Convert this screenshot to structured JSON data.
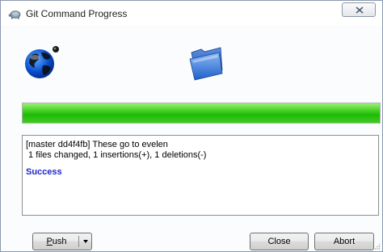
{
  "window": {
    "title": "Git Command Progress",
    "title_icon": "tortoisegit-icon",
    "close_icon": "close-icon"
  },
  "status_icons": {
    "remote": "globe-icon",
    "local": "folder-icon"
  },
  "progress": {
    "value": 1.0,
    "fill_color": "#2ec512"
  },
  "log": {
    "lines": [
      "[master dd4f4fb] These go to evelen",
      " 1 files changed, 1 insertions(+), 1 deletions(-)"
    ],
    "result": "Success",
    "result_color": "#1f24cc"
  },
  "buttons": {
    "push_accel": "P",
    "push_rest": "ush",
    "close": "Close",
    "abort": "Abort"
  }
}
